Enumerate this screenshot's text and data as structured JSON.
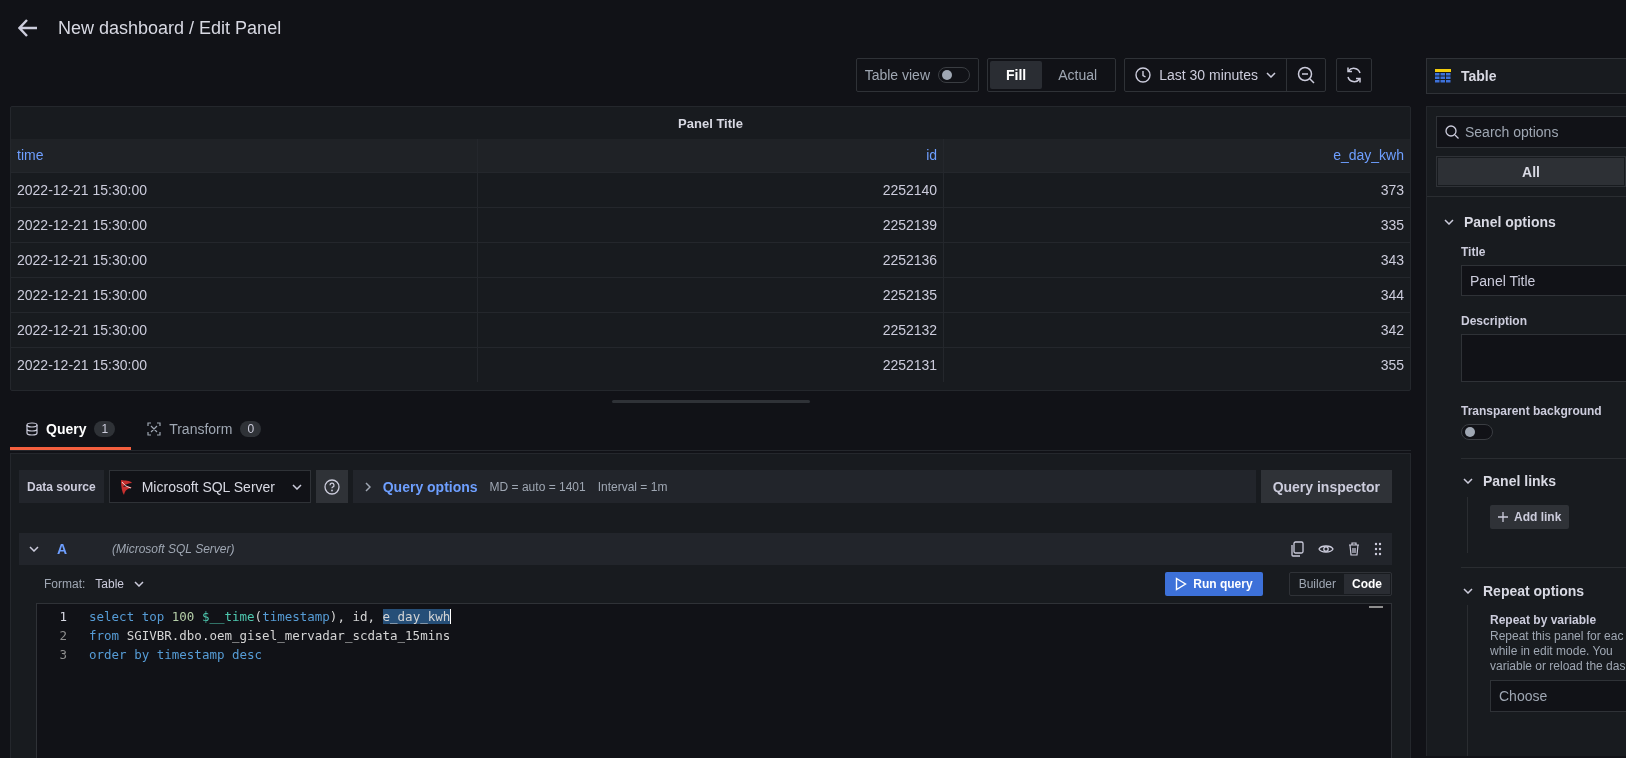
{
  "header": {
    "title": "New dashboard / Edit Panel"
  },
  "toolbar": {
    "table_view": {
      "label": "Table view",
      "on": false
    },
    "display_modes": [
      {
        "label": "Fill",
        "selected": true
      },
      {
        "label": "Actual",
        "selected": false
      }
    ],
    "time_range": "Last 30 minutes"
  },
  "visualization": {
    "label": "Table"
  },
  "table": {
    "title": "Panel Title",
    "columns": [
      {
        "label": "time",
        "kind": "text"
      },
      {
        "label": "id",
        "kind": "number"
      },
      {
        "label": "e_day_kwh",
        "kind": "number"
      }
    ],
    "rows": [
      [
        "2022-12-21 15:30:00",
        "2252140",
        "373"
      ],
      [
        "2022-12-21 15:30:00",
        "2252139",
        "335"
      ],
      [
        "2022-12-21 15:30:00",
        "2252136",
        "343"
      ],
      [
        "2022-12-21 15:30:00",
        "2252135",
        "344"
      ],
      [
        "2022-12-21 15:30:00",
        "2252132",
        "342"
      ],
      [
        "2022-12-21 15:30:00",
        "2252131",
        "355"
      ]
    ]
  },
  "query_tabs": [
    {
      "label": "Query",
      "count": "1",
      "selected": true
    },
    {
      "label": "Transform",
      "count": "0",
      "selected": false
    }
  ],
  "data_source": {
    "label": "Data source",
    "name": "Microsoft SQL Server",
    "query_options": "Query options",
    "max_data_points": "MD = auto = 1401",
    "interval": "Interval = 1m",
    "inspector": "Query inspector"
  },
  "query": {
    "ref": "A",
    "source": "(Microsoft SQL Server)",
    "expanded": true,
    "format_label": "Format:",
    "format": "Table",
    "run": "Run query",
    "editor_modes": [
      {
        "label": "Builder",
        "selected": false
      },
      {
        "label": "Code",
        "selected": true
      }
    ],
    "code_lines": [
      {
        "number": "1",
        "tokens": [
          {
            "kind": "keyword",
            "text": "select top "
          },
          {
            "kind": "number",
            "text": "100 "
          },
          {
            "kind": "macro",
            "text": "$__time"
          },
          {
            "kind": "plain",
            "text": "("
          },
          {
            "kind": "keyword",
            "text": "timestamp"
          },
          {
            "kind": "plain",
            "text": "), id, "
          },
          {
            "kind": "selection",
            "text": "e_day_kwh"
          }
        ]
      },
      {
        "number": "2",
        "tokens": [
          {
            "kind": "keyword",
            "text": "from "
          },
          {
            "kind": "plain",
            "text": "SGIVBR.dbo.oem_gisel_mervadar_scdata_15mins"
          }
        ]
      },
      {
        "number": "3",
        "tokens": [
          {
            "kind": "keyword",
            "text": "order by timestamp desc"
          }
        ]
      }
    ]
  },
  "options": {
    "search": {
      "placeholder": "Search options"
    },
    "filters": [
      {
        "label": "All",
        "selected": true
      }
    ],
    "panel_options": {
      "title": "Panel options",
      "expanded": true,
      "title_label": "Title",
      "title_value": "Panel Title",
      "description_label": "Description",
      "transparent_label": "Transparent background",
      "transparent_on": false
    },
    "panel_links": {
      "title": "Panel links",
      "expanded": true,
      "add": "Add link"
    },
    "repeat_options": {
      "title": "Repeat options",
      "expanded": true,
      "label": "Repeat by variable",
      "help_lines": [
        "Repeat this panel for eac",
        "while in edit mode. You",
        "variable or reload the das"
      ],
      "placeholder": "Choose"
    }
  }
}
